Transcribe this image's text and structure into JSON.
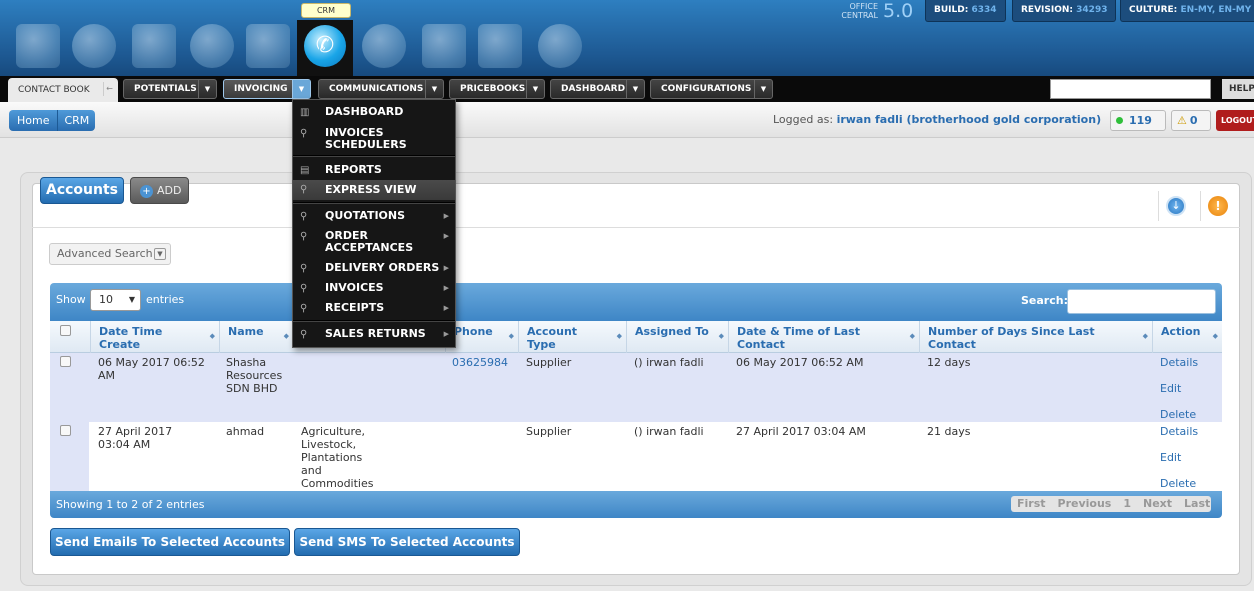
{
  "top": {
    "crm_tooltip": "CRM",
    "brand_line1": "OFFICE",
    "brand_line2": "CENTRAL",
    "version": "5.0",
    "build_label": "BUILD:",
    "build_value": "6334",
    "revision_label": "REVISION:",
    "revision_value": "34293",
    "culture_label": "CULTURE:",
    "culture_value": "EN-MY, EN-MY"
  },
  "nav": {
    "contact_book": "CONTACT BOOK",
    "items": [
      "POTENTIALS",
      "INVOICING",
      "COMMUNICATIONS",
      "PRICEBOOKS",
      "DASHBOARD",
      "CONFIGURATIONS"
    ],
    "help": "HELP"
  },
  "breadcrumb": {
    "home": "Home",
    "crm": "CRM"
  },
  "user": {
    "logged_as": "Logged as:",
    "name": "irwan fadli (brotherhood gold corporation)",
    "online_count": "119",
    "alert_count": "0",
    "logout": "LOGOUT"
  },
  "menu": {
    "dashboard": "DASHBOARD",
    "invoices_schedulers_1": "INVOICES",
    "invoices_schedulers_2": "SCHEDULERS",
    "reports": "REPORTS",
    "express_view": "EXPRESS VIEW",
    "quotations": "QUOTATIONS",
    "order_acc_1": "ORDER",
    "order_acc_2": "ACCEPTANCES",
    "delivery_orders": "DELIVERY ORDERS",
    "invoices": "INVOICES",
    "receipts": "RECEIPTS",
    "sales_returns": "SALES RETURNS"
  },
  "panel": {
    "title": "Accounts",
    "add": "ADD",
    "advanced_search": "Advanced Search"
  },
  "table": {
    "show": "Show",
    "page_size": "10",
    "entries": "entries",
    "search_label": "Search:",
    "search_value": "",
    "headers": {
      "date1": "Date Time",
      "date2": "Create",
      "name": "Name",
      "phone": "Phone",
      "acct1": "Account",
      "acct2": "Type",
      "assigned": "Assigned To",
      "last1": "Date & Time of Last",
      "last2": "Contact",
      "days1": "Number of Days Since Last",
      "days2": "Contact",
      "action": "Action"
    },
    "rows": [
      {
        "date1": "06 May 2017 06:52",
        "date2": "AM",
        "name1": "Shasha",
        "name2": "Resources",
        "name3": "SDN BHD",
        "phone": "03625984",
        "type": "Supplier",
        "assigned": "() irwan fadli",
        "last": "06 May 2017 06:52 AM",
        "days": "12 days"
      },
      {
        "date1": "27 April 2017",
        "date2": "03:04 AM",
        "name1": "ahmad",
        "industry": [
          "Agriculture,",
          "Livestock,",
          "Plantations",
          "and",
          "Commodities"
        ],
        "type": "Supplier",
        "assigned": "() irwan fadli",
        "last": "27 April 2017 03:04 AM",
        "days": "21 days"
      }
    ],
    "actions": {
      "details": "Details",
      "edit": "Edit",
      "delete": "Delete"
    },
    "showing": "Showing 1 to 2 of 2 entries",
    "pager": {
      "first": "First",
      "previous": "Previous",
      "page": "1",
      "next": "Next",
      "last": "Last"
    }
  },
  "buttons": {
    "send_emails": "Send Emails To Selected Accounts",
    "send_sms": "Send SMS To Selected Accounts"
  }
}
